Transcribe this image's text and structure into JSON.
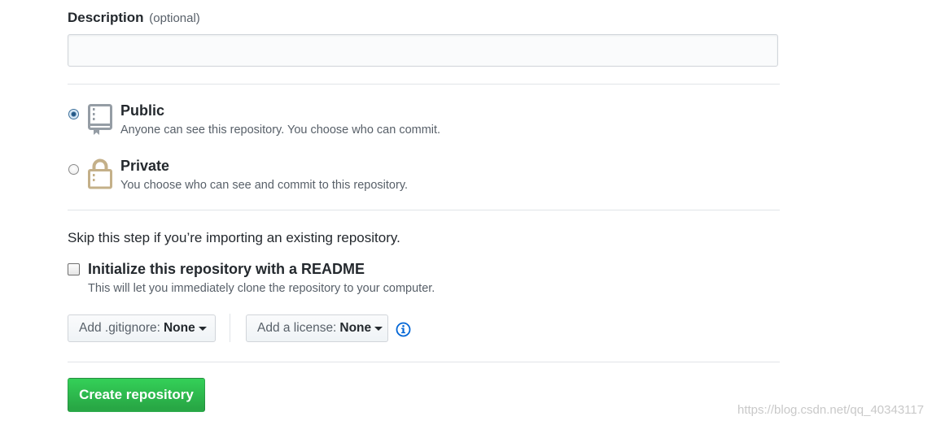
{
  "description": {
    "label": "Description",
    "optional_hint": "(optional)",
    "value": "",
    "placeholder": ""
  },
  "visibility": {
    "selected": "public",
    "public": {
      "title": "Public",
      "note": "Anyone can see this repository. You choose who can commit.",
      "icon": "repo-icon"
    },
    "private": {
      "title": "Private",
      "note": "You choose who can see and commit to this repository.",
      "icon": "lock-icon"
    }
  },
  "init": {
    "skip_text": "Skip this step if you’re importing an existing repository.",
    "readme_label": "Initialize this repository with a README",
    "readme_note": "This will let you immediately clone the repository to your computer.",
    "readme_checked": false
  },
  "gitignore": {
    "label": "Add .gitignore:",
    "value": "None"
  },
  "license": {
    "label": "Add a license:",
    "value": "None"
  },
  "create_button": {
    "label": "Create repository"
  },
  "watermark": "https://blog.csdn.net/qq_40343117",
  "colors": {
    "primary_green": "#28a745",
    "link_blue": "#0366d6",
    "lock_tan": "#c4b089",
    "repo_gray": "#959da5"
  }
}
